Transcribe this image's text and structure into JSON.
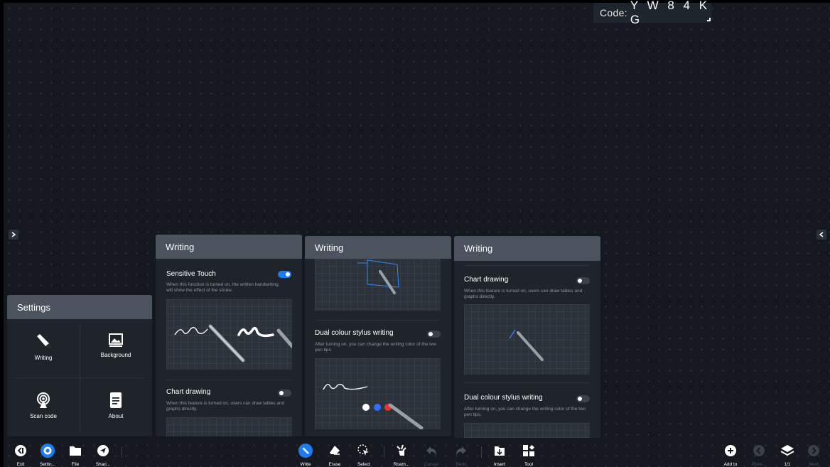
{
  "share_code": {
    "label": "Code:",
    "value": "Y W 8 4 K G"
  },
  "settings_panel": {
    "title": "Settings",
    "items": [
      {
        "label": "Writing",
        "icon": "pen-icon"
      },
      {
        "label": "Background",
        "icon": "image-icon"
      },
      {
        "label": "Scan code",
        "icon": "broadcast-icon"
      },
      {
        "label": "About",
        "icon": "document-icon"
      }
    ]
  },
  "writing_panel_1": {
    "title": "Writing",
    "sensitive_touch": {
      "title": "Sensitive Touch",
      "desc": "When this function is turned on, the written handwriting will show the effect of the stroke.",
      "enabled": true
    },
    "chart_drawing": {
      "title": "Chart drawing",
      "desc": "When this feature is turned on, users can draw tables and graphs directly.",
      "enabled": false
    }
  },
  "writing_panel_2": {
    "title": "Writing",
    "dual_colour": {
      "title": "Dual colour stylus writing",
      "desc": "After turning on, you can change the writing color of the two pen tips.",
      "enabled": false
    }
  },
  "writing_panel_3": {
    "title": "Writing",
    "chart_drawing": {
      "title": "Chart drawing",
      "desc": "When this feature is turned on, users can draw tables and graphs directly.",
      "enabled": false
    },
    "dual_colour": {
      "title": "Dual colour stylus writing",
      "desc": "After turning on, you can change the writing color of the two pen tips.",
      "enabled": false
    }
  },
  "toolbar": {
    "left": [
      {
        "label": "Exit",
        "icon": "exit-icon"
      },
      {
        "label": "Settin...",
        "icon": "settings-icon"
      },
      {
        "label": "File",
        "icon": "folder-icon"
      },
      {
        "label": "Shari...",
        "icon": "share-icon"
      }
    ],
    "center": [
      {
        "label": "Write",
        "icon": "pen-icon"
      },
      {
        "label": "Erase",
        "icon": "eraser-icon"
      },
      {
        "label": "Select",
        "icon": "select-icon"
      },
      {
        "label": "Roam...",
        "icon": "roam-icon"
      },
      {
        "label": "Cancel",
        "icon": "undo-icon"
      },
      {
        "label": "Redo",
        "icon": "redo-icon"
      },
      {
        "label": "Insert",
        "icon": "insert-icon"
      },
      {
        "label": "Tool",
        "icon": "tool-icon"
      }
    ],
    "right": [
      {
        "label": "Add to",
        "icon": "add-icon"
      },
      {
        "label": "Previ...",
        "icon": "prev-icon"
      },
      {
        "label": "1/1",
        "icon": "layers-icon"
      },
      {
        "label": "Next",
        "icon": "next-icon"
      }
    ]
  },
  "colors": {
    "accent": "#1e7cf2",
    "panel_header": "#4a535e",
    "panel_body": "#1f242b",
    "canvas": "#15191f"
  }
}
